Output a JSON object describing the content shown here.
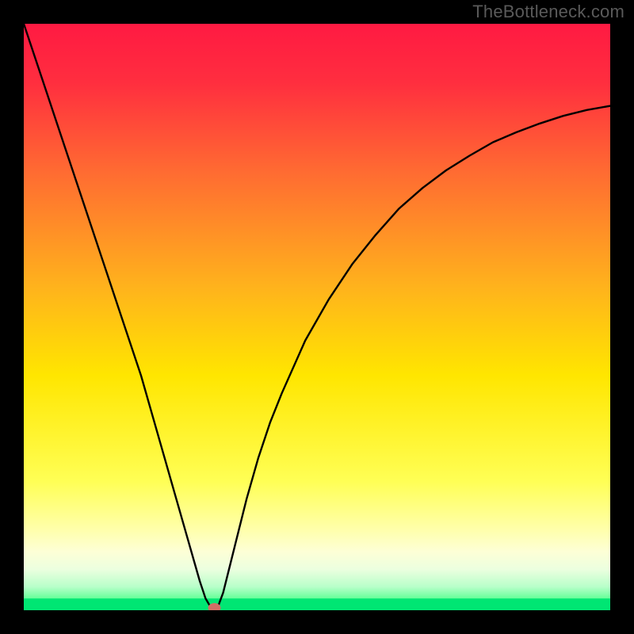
{
  "watermark": "TheBottleneck.com",
  "chart_data": {
    "type": "line",
    "title": "",
    "xlabel": "",
    "ylabel": "",
    "xlim": [
      0,
      100
    ],
    "ylim": [
      0,
      100
    ],
    "x": [
      0,
      2,
      4,
      6,
      8,
      10,
      12,
      14,
      16,
      18,
      20,
      22,
      24,
      26,
      28,
      30,
      31,
      32,
      32.5,
      33,
      34,
      36,
      38,
      40,
      42,
      44,
      48,
      52,
      56,
      60,
      64,
      68,
      72,
      76,
      80,
      84,
      88,
      92,
      96,
      100
    ],
    "values": [
      100,
      94,
      88,
      82,
      76,
      70,
      64,
      58,
      52,
      46,
      40,
      33,
      26,
      19,
      12,
      5,
      2,
      0.3,
      0,
      0.3,
      3,
      11,
      19,
      26,
      32,
      37,
      46,
      53,
      59,
      64,
      68.5,
      72,
      75,
      77.5,
      79.8,
      81.5,
      83,
      84.3,
      85.3,
      86
    ],
    "marker": {
      "x": 32.5,
      "y": 0
    },
    "green_band": {
      "y_start": 0,
      "y_end": 2
    },
    "light_band": {
      "y_start": 2,
      "y_end": 11
    },
    "gradient_stops": [
      {
        "pct": 0,
        "color": "#ff1a42"
      },
      {
        "pct": 10,
        "color": "#ff2e3f"
      },
      {
        "pct": 25,
        "color": "#ff6a32"
      },
      {
        "pct": 45,
        "color": "#ffb31c"
      },
      {
        "pct": 60,
        "color": "#ffe600"
      },
      {
        "pct": 78,
        "color": "#ffff55"
      },
      {
        "pct": 86,
        "color": "#ffffa8"
      },
      {
        "pct": 90,
        "color": "#fdffd6"
      },
      {
        "pct": 93,
        "color": "#ecffdf"
      },
      {
        "pct": 96,
        "color": "#b8ffc9"
      },
      {
        "pct": 98,
        "color": "#66ff99"
      },
      {
        "pct": 100,
        "color": "#00e673"
      }
    ]
  }
}
